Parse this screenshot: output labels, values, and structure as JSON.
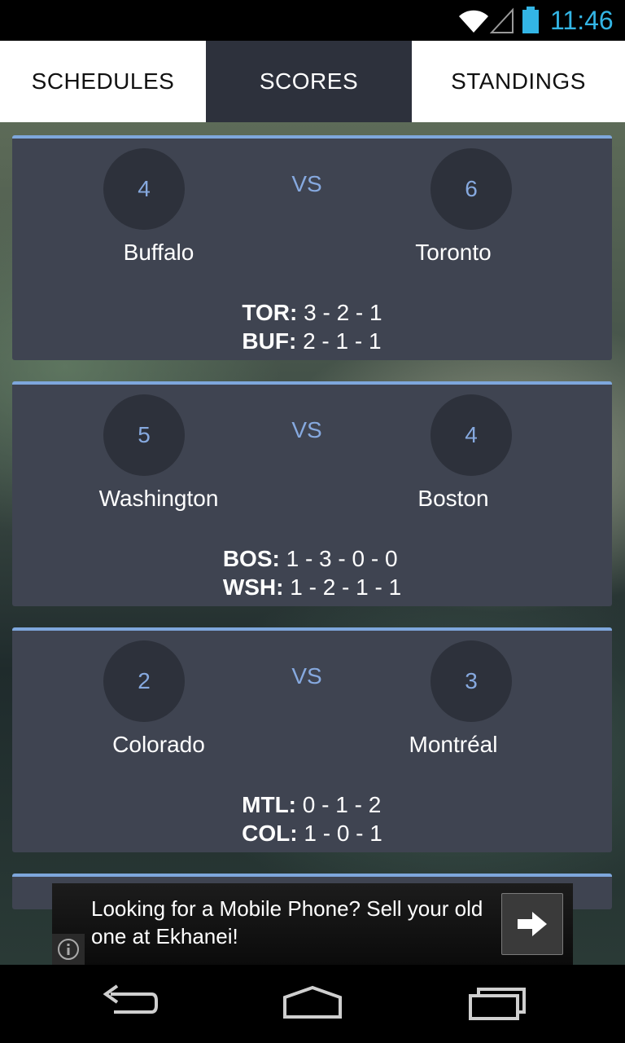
{
  "status_bar": {
    "time": "11:46",
    "accent_color": "#33b5e5",
    "icons": [
      "wifi-icon",
      "signal-icon",
      "battery-icon"
    ]
  },
  "tabs": [
    {
      "label": "SCHEDULES",
      "selected": false
    },
    {
      "label": "SCORES",
      "selected": true
    },
    {
      "label": "STANDINGS",
      "selected": false
    }
  ],
  "games": [
    {
      "home_score": "4",
      "away_score": "6",
      "vs": "VS",
      "home_team": "Buffalo",
      "away_team": "Toronto",
      "line1_team": "TOR:",
      "line1_periods": "3 - 2 - 1",
      "line2_team": "BUF:",
      "line2_periods": "2 - 1 - 1"
    },
    {
      "home_score": "5",
      "away_score": "4",
      "vs": "VS",
      "home_team": "Washington",
      "away_team": "Boston",
      "line1_team": "BOS:",
      "line1_periods": "1 - 3 - 0 - 0",
      "line2_team": "WSH:",
      "line2_periods": "1 - 2 - 1 - 1"
    },
    {
      "home_score": "2",
      "away_score": "3",
      "vs": "VS",
      "home_team": "Colorado",
      "away_team": "Montréal",
      "line1_team": "MTL:",
      "line1_periods": "0 - 1 - 2",
      "line2_team": "COL:",
      "line2_periods": "1 - 0 - 1"
    }
  ],
  "ad": {
    "text": "Looking for a Mobile Phone? Sell your old one at Ekhanei!",
    "arrow_icon": "arrow-right-icon",
    "info_icon": "info-icon"
  },
  "nav": {
    "icons": [
      "back-icon",
      "home-icon",
      "recent-apps-icon"
    ]
  },
  "colors": {
    "card_background": "#3f4451",
    "card_accent": "#7ea7dc",
    "score_text": "#86a9df",
    "selected_tab": "#2d313c"
  }
}
